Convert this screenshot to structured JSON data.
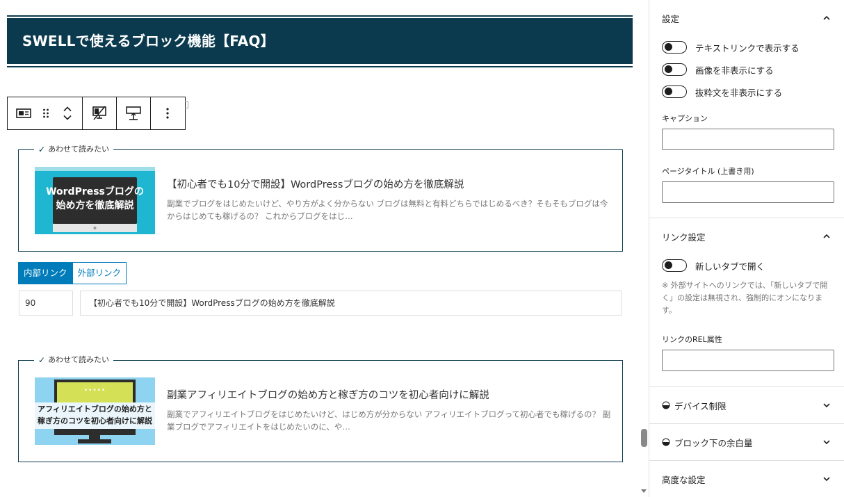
{
  "heading": {
    "text": "SWELLで使えるブロック機能【FAQ】"
  },
  "cards": [
    {
      "label": "あわせて読みたい",
      "thumb_text_top": "WordPressブログの",
      "thumb_text_bottom": "始め方を徹底解説",
      "title": "【初心者でも10分で開設】WordPressブログの始め方を徹底解説",
      "excerpt": "副業でブログをはじめたいけど、やり方がよく分からない ブログは無料と有料どちらではじめるべき？そもそもブログは今からはじめても稼げるの？ これからブログをはじ…"
    },
    {
      "label": "あわせて読みたい",
      "thumb_text_top": "アフィリエイトブログの始め方と",
      "thumb_text_bottom": "稼ぎ方のコツを初心者向けに解説",
      "thumb_dots": "•••••",
      "title": "副業アフィリエイトブログの始め方と稼ぎ方のコツを初心者向けに解説",
      "excerpt": "副業でアフィリエイトブログをはじめたいけど、はじめ方が分からない アフィリエイトブログって初心者でも稼げるの？ 副業ブログでアフィリエイトをはじめたいのに、や…"
    }
  ],
  "link_tabs": {
    "internal": "内部リンク",
    "external": "外部リンク"
  },
  "post_id": "90",
  "post_title_value": "【初心者でも10分で開設】WordPressブログの始め方を徹底解説",
  "sidebar": {
    "settings": {
      "title": "設定",
      "toggles": [
        "テキストリンクで表示する",
        "画像を非表示にする",
        "抜粋文を非表示にする"
      ],
      "caption_label": "キャプション",
      "page_title_label": "ページタイトル (上書き用)"
    },
    "link_settings": {
      "title": "リンク設定",
      "new_tab_label": "新しいタブで開く",
      "note": "※ 外部サイトへのリンクでは、「新しいタブで開く」の設定は無視され、強制的にオンになります。",
      "rel_label": "リンクのREL属性"
    },
    "device_title": "デバイス制限",
    "margin_title": "ブロック下の余白量",
    "advanced_title": "高度な設定"
  },
  "colors": {
    "accent": "#0b3a4e",
    "wp_blue": "#007cba"
  }
}
